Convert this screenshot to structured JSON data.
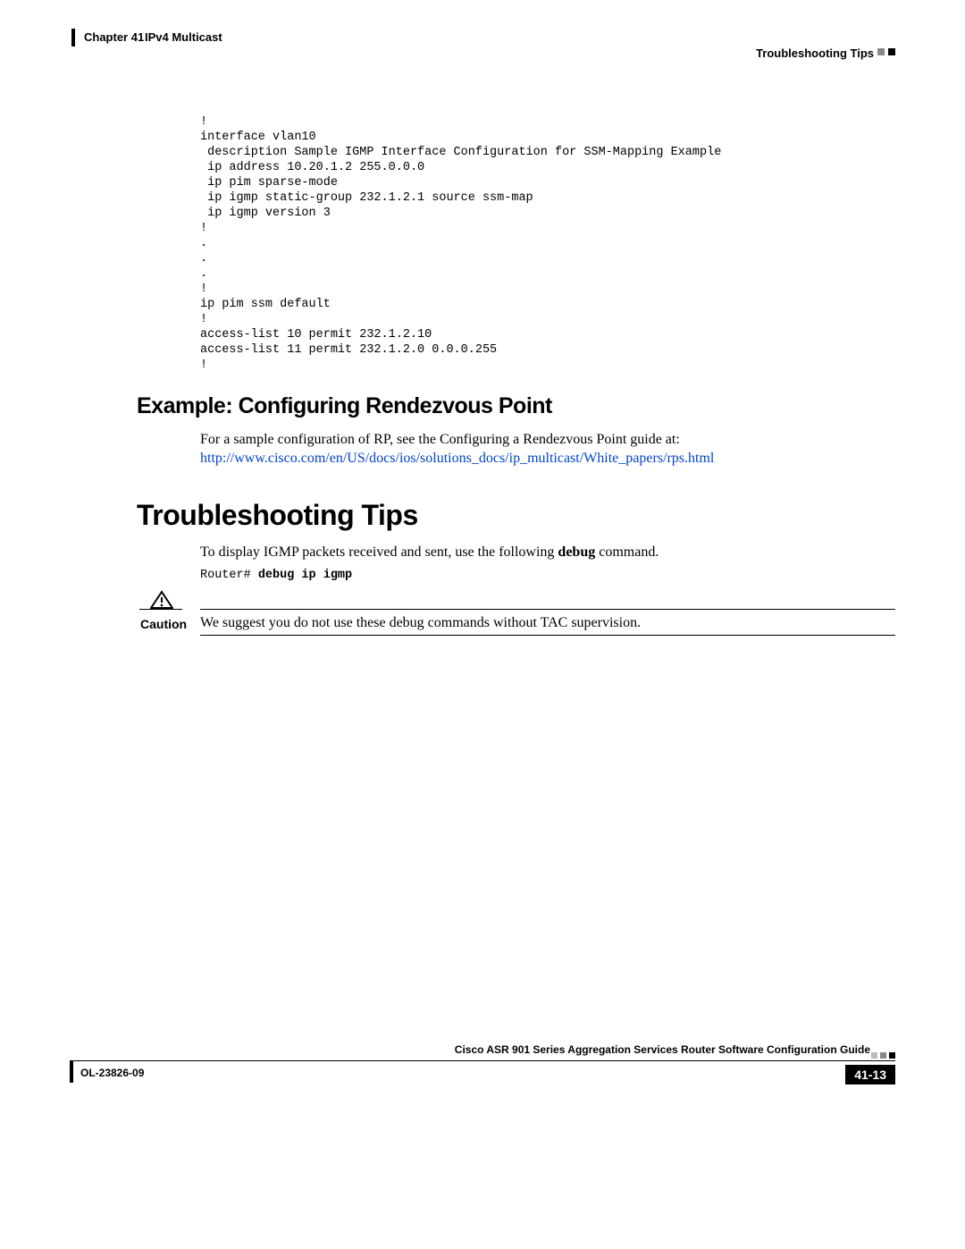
{
  "header": {
    "chapter_label": "Chapter 41",
    "chapter_title": "IPv4 Multicast",
    "section": "Troubleshooting Tips"
  },
  "code": "!\ninterface vlan10\n description Sample IGMP Interface Configuration for SSM-Mapping Example\n ip address 10.20.1.2 255.0.0.0\n ip pim sparse-mode\n ip igmp static-group 232.1.2.1 source ssm-map\n ip igmp version 3\n!\n.\n.\n.\n!\nip pim ssm default\n!\naccess-list 10 permit 232.1.2.10\naccess-list 11 permit 232.1.2.0 0.0.0.255\n!",
  "h2_example": "Example: Configuring Rendezvous Point",
  "rp_text": "For a sample configuration of RP, see the Configuring a Rendezvous Point guide at:",
  "rp_link": "http://www.cisco.com/en/US/docs/ios/solutions_docs/ip_multicast/White_papers/rps.html",
  "h1": "Troubleshooting Tips",
  "debug_text_pre": "To display IGMP packets received and sent, use the following ",
  "debug_bold": "debug",
  "debug_text_post": " command.",
  "cmd_prompt": "Router# ",
  "cmd_bold": "debug ip igmp",
  "caution_label": "Caution",
  "caution_text": "We suggest you do not use these debug commands without TAC supervision.",
  "footer": {
    "guide": "Cisco ASR 901 Series Aggregation Services Router Software Configuration Guide",
    "doc_id": "OL-23826-09",
    "page": "41-13"
  }
}
